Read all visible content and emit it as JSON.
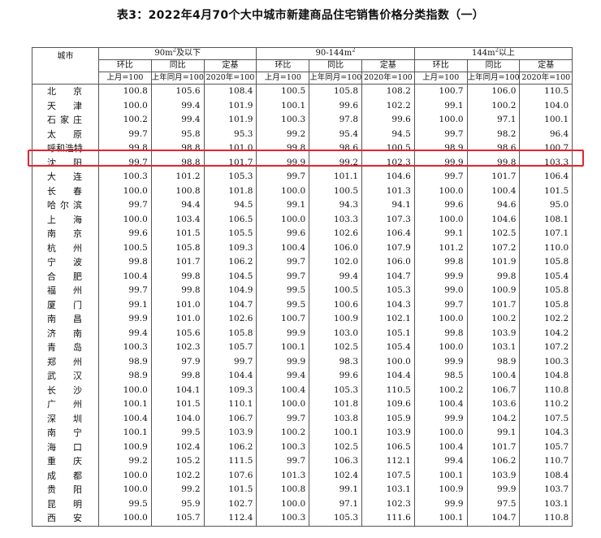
{
  "title": "表3：2022年4月70个大中城市新建商品住宅销售价格分类指数（一）",
  "table": {
    "city_header": "城市",
    "groups": [
      {
        "base": "90m",
        "sup": "2",
        "suffix": "及以下"
      },
      {
        "base": "90-144m",
        "sup": "2",
        "suffix": ""
      },
      {
        "base": "144m",
        "sup": "2",
        "suffix": "以上"
      }
    ],
    "subheaders": [
      "环比",
      "同比",
      "定基"
    ],
    "bases": [
      "上月=100",
      "上年同月=100",
      "2020年=100"
    ],
    "rows": [
      {
        "city": "北京",
        "v": [
          "100.8",
          "105.6",
          "108.4",
          "100.5",
          "105.8",
          "108.2",
          "100.7",
          "106.0",
          "110.5"
        ]
      },
      {
        "city": "天津",
        "v": [
          "100.0",
          "99.4",
          "101.9",
          "100.1",
          "99.6",
          "102.2",
          "99.1",
          "100.2",
          "104.0"
        ]
      },
      {
        "city": "石家庄",
        "v": [
          "100.2",
          "99.4",
          "101.9",
          "100.3",
          "97.8",
          "99.6",
          "100.0",
          "97.1",
          "100.1"
        ]
      },
      {
        "city": "太原",
        "v": [
          "99.7",
          "95.8",
          "95.3",
          "99.2",
          "95.4",
          "94.5",
          "99.7",
          "98.2",
          "96.4"
        ]
      },
      {
        "city": "呼和浩特",
        "v": [
          "99.8",
          "98.8",
          "101.0",
          "99.8",
          "98.6",
          "100.5",
          "98.9",
          "98.6",
          "100.7"
        ],
        "highlight": true
      },
      {
        "city": "沈阳",
        "v": [
          "99.7",
          "98.8",
          "101.7",
          "99.9",
          "99.2",
          "102.3",
          "99.9",
          "99.8",
          "103.3"
        ]
      },
      {
        "city": "大连",
        "v": [
          "100.3",
          "101.2",
          "105.3",
          "99.7",
          "101.1",
          "104.6",
          "99.7",
          "101.7",
          "106.4"
        ]
      },
      {
        "city": "长春",
        "v": [
          "100.0",
          "100.8",
          "101.8",
          "100.0",
          "100.5",
          "101.3",
          "100.0",
          "100.4",
          "101.5"
        ]
      },
      {
        "city": "哈尔滨",
        "v": [
          "99.7",
          "94.4",
          "94.5",
          "99.1",
          "94.3",
          "94.1",
          "99.6",
          "94.6",
          "95.0"
        ]
      },
      {
        "city": "上海",
        "v": [
          "100.0",
          "103.4",
          "106.5",
          "100.0",
          "103.3",
          "107.3",
          "100.0",
          "104.6",
          "108.1"
        ]
      },
      {
        "city": "南京",
        "v": [
          "99.6",
          "101.5",
          "105.5",
          "99.6",
          "102.6",
          "106.4",
          "99.1",
          "102.5",
          "107.1"
        ]
      },
      {
        "city": "杭州",
        "v": [
          "100.5",
          "105.8",
          "109.3",
          "100.4",
          "106.0",
          "107.9",
          "101.2",
          "107.2",
          "110.0"
        ]
      },
      {
        "city": "宁波",
        "v": [
          "99.8",
          "101.7",
          "106.2",
          "99.7",
          "102.0",
          "106.0",
          "99.8",
          "101.9",
          "105.8"
        ]
      },
      {
        "city": "合肥",
        "v": [
          "100.4",
          "99.8",
          "104.5",
          "99.7",
          "99.4",
          "104.7",
          "99.9",
          "99.8",
          "105.4"
        ]
      },
      {
        "city": "福州",
        "v": [
          "99.7",
          "99.8",
          "104.9",
          "99.5",
          "100.5",
          "105.3",
          "99.0",
          "100.9",
          "105.8"
        ]
      },
      {
        "city": "厦门",
        "v": [
          "99.1",
          "101.0",
          "104.7",
          "99.5",
          "100.6",
          "104.3",
          "99.7",
          "101.7",
          "105.8"
        ]
      },
      {
        "city": "南昌",
        "v": [
          "99.9",
          "101.0",
          "102.6",
          "100.7",
          "100.9",
          "102.1",
          "100.0",
          "100.2",
          "102.2"
        ]
      },
      {
        "city": "济南",
        "v": [
          "99.4",
          "105.6",
          "105.8",
          "99.9",
          "103.0",
          "105.1",
          "99.8",
          "103.9",
          "104.2"
        ]
      },
      {
        "city": "青岛",
        "v": [
          "100.3",
          "102.3",
          "105.7",
          "100.1",
          "102.5",
          "105.4",
          "100.0",
          "103.1",
          "107.2"
        ]
      },
      {
        "city": "郑州",
        "v": [
          "98.9",
          "97.9",
          "99.7",
          "99.9",
          "98.3",
          "100.0",
          "99.9",
          "98.9",
          "100.3"
        ]
      },
      {
        "city": "武汉",
        "v": [
          "98.9",
          "99.8",
          "104.4",
          "99.4",
          "99.6",
          "104.4",
          "98.5",
          "100.4",
          "104.8"
        ]
      },
      {
        "city": "长沙",
        "v": [
          "100.0",
          "104.1",
          "109.3",
          "100.4",
          "105.3",
          "110.5",
          "100.2",
          "106.7",
          "110.8"
        ]
      },
      {
        "city": "广州",
        "v": [
          "100.1",
          "101.5",
          "110.1",
          "100.0",
          "101.8",
          "109.6",
          "100.4",
          "103.6",
          "110.2"
        ]
      },
      {
        "city": "深圳",
        "v": [
          "100.4",
          "104.0",
          "106.7",
          "99.7",
          "103.8",
          "105.9",
          "99.9",
          "104.2",
          "107.5"
        ]
      },
      {
        "city": "南宁",
        "v": [
          "100.1",
          "99.5",
          "103.9",
          "100.2",
          "100.1",
          "103.9",
          "100.0",
          "99.1",
          "104.3"
        ]
      },
      {
        "city": "海口",
        "v": [
          "100.9",
          "102.4",
          "106.2",
          "100.3",
          "102.5",
          "106.5",
          "100.4",
          "101.7",
          "105.7"
        ]
      },
      {
        "city": "重庆",
        "v": [
          "99.2",
          "105.2",
          "111.5",
          "99.7",
          "106.3",
          "112.1",
          "99.4",
          "106.2",
          "110.7"
        ]
      },
      {
        "city": "成都",
        "v": [
          "100.0",
          "102.2",
          "107.6",
          "101.3",
          "102.4",
          "107.5",
          "100.1",
          "103.9",
          "108.4"
        ]
      },
      {
        "city": "贵阳",
        "v": [
          "100.0",
          "99.2",
          "101.5",
          "100.8",
          "99.1",
          "103.1",
          "100.9",
          "99.9",
          "103.7"
        ]
      },
      {
        "city": "昆明",
        "v": [
          "99.5",
          "95.9",
          "102.7",
          "100.0",
          "97.1",
          "102.3",
          "99.9",
          "97.5",
          "103.1"
        ]
      },
      {
        "city": "西安",
        "v": [
          "100.0",
          "105.7",
          "112.4",
          "100.3",
          "105.3",
          "111.6",
          "100.1",
          "104.7",
          "110.8"
        ]
      }
    ]
  },
  "colors": {
    "highlight": "#e8232b"
  }
}
